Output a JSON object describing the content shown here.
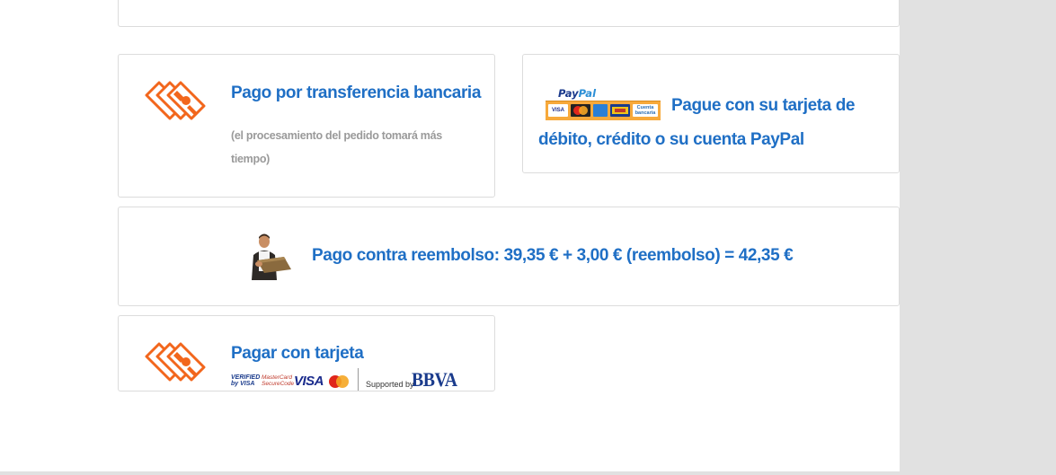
{
  "payment_options": {
    "transfer": {
      "title": "Pago por transferencia bancaria",
      "note": "(el procesamiento del pedido tomará más tiempo)",
      "icon": "money-bills-icon"
    },
    "paypal": {
      "title": "Pague con su tarjeta de débito, crédito o su cuenta PayPal",
      "logo_text_1": "Pay",
      "logo_text_2": "Pal",
      "card_visa": "VISA",
      "card_bank": "Cuenta bancaria",
      "icon": "paypal-cards-logo"
    },
    "cod": {
      "title": "Pago contra reembolso: 39,35 € + 3,00 € (reembolso) = 42,35 €",
      "icon": "delivery-man-icon"
    },
    "card": {
      "title": "Pagar con tarjeta",
      "verified_by_visa": "VERIFIED by VISA",
      "mastercard_securecode": "MasterCard SecureCode",
      "visa": "VISA",
      "supported_by": "Supported by",
      "bbva": "BBVA",
      "icon": "money-bills-icon"
    }
  },
  "colors": {
    "accent_blue": "#1f6fc5",
    "icon_orange": "#f2661c",
    "note_gray": "#9a9a9a",
    "border": "#dcdcdc",
    "sidebar_bg": "#e1e1e1"
  }
}
